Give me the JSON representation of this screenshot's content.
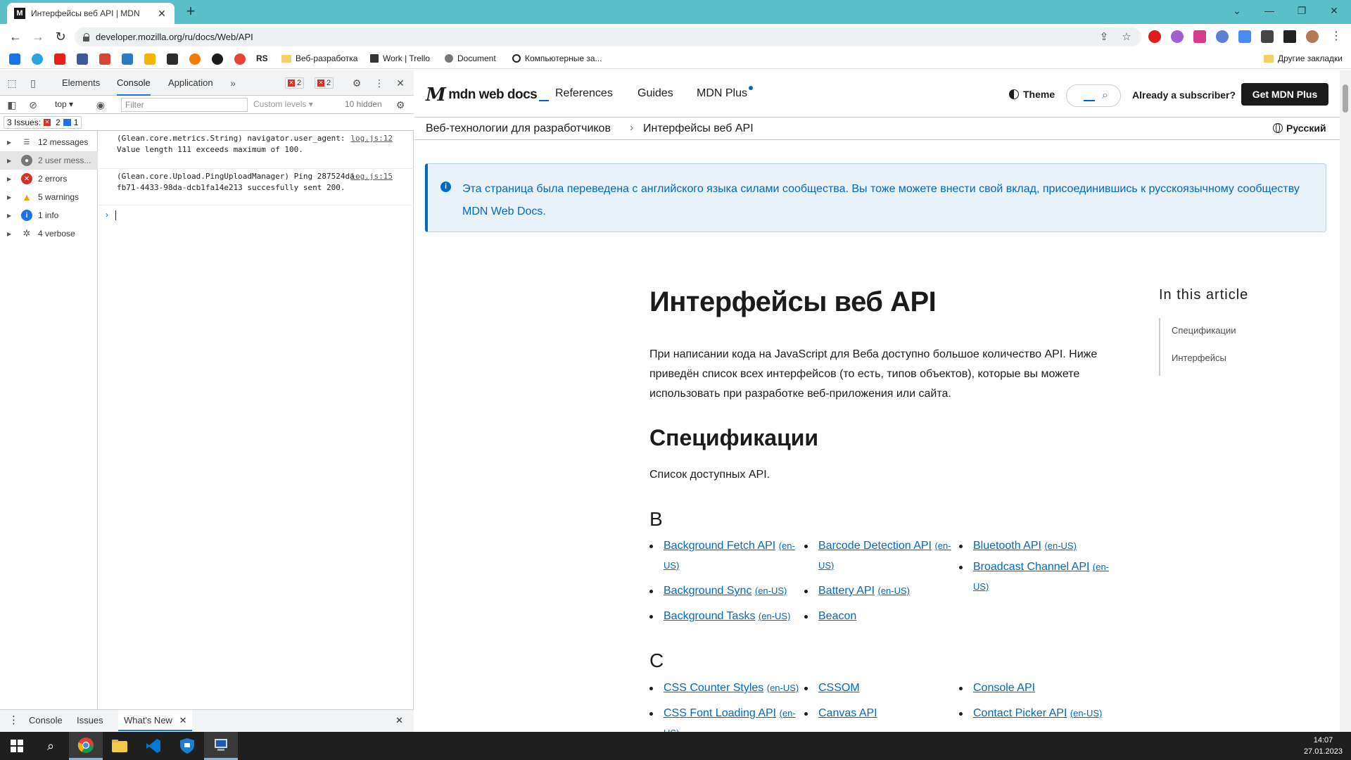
{
  "browser": {
    "tab_title": "Интерфейсы веб API | MDN",
    "url": "developer.mozilla.org/ru/docs/Web/API",
    "bookmarks": [
      "Веб-разработка",
      "Work | Trello",
      "Document",
      "Компьютерные за...",
      "Другие закладки"
    ],
    "bookmarks_short_rs": "RS"
  },
  "devtools": {
    "tabs": [
      "Elements",
      "Console",
      "Application"
    ],
    "error_count": "2",
    "issue_count": "2",
    "context": "top",
    "filter_placeholder": "Filter",
    "levels": "Custom levels",
    "hidden": "10 hidden",
    "issues_label": "3 Issues:",
    "issues_errors": "2",
    "issues_messages": "1",
    "sidebar": [
      {
        "label": "12 messages",
        "icon": "list-icon"
      },
      {
        "label": "2 user mess...",
        "icon": "user-icon"
      },
      {
        "label": "2 errors",
        "icon": "error-icon"
      },
      {
        "label": "5 warnings",
        "icon": "warning-icon"
      },
      {
        "label": "1 info",
        "icon": "info-icon"
      },
      {
        "label": "4 verbose",
        "icon": "bug-icon"
      }
    ],
    "logs": [
      {
        "text": "(Glean.core.metrics.String) navigator.user_agent: Value length 111 exceeds maximum of 100.",
        "src": "log.js:12"
      },
      {
        "text": "(Glean.core.Upload.PingUploadManager) Ping 287524da-fb71-4433-98da-dcb1fa14e213 succesfully sent 200.",
        "src": "log.js:15"
      }
    ],
    "drawer_tabs": [
      "Console",
      "Issues",
      "What's New"
    ]
  },
  "mdn": {
    "logo": "mdn web docs",
    "nav": [
      "References",
      "Guides",
      "MDN Plus"
    ],
    "theme": "Theme",
    "subscriber": "Already a subscriber?",
    "get_plus": "Get MDN Plus",
    "breadcrumbs": [
      "Веб-технологии для разработчиков",
      "Интерфейсы веб API"
    ],
    "language": "Русский",
    "notice": "Эта страница была переведена с английского языка силами сообщества. Вы тоже можете внести свой вклад, присоединившись к русскоязычному сообществу MDN Web Docs.",
    "title": "Интерфейсы веб API",
    "intro": "При написании кода на JavaScript для Веба доступно большое количество API. Ниже приведён список всех интерфейсов (то есть, типов объектов), которые вы можете использовать при разработке веб-приложения или сайта.",
    "h2": "Спецификации",
    "sublead": "Список доступных API.",
    "letter_b": "B",
    "letter_c": "C",
    "en_us": "(en-US)",
    "toc_title": "In this article",
    "toc": [
      "Спецификации",
      "Интерфейсы"
    ],
    "b_col1": [
      "Background Fetch API",
      "Background Sync",
      "Background Tasks"
    ],
    "b_col2": [
      "Barcode Detection API",
      "Battery API",
      "Beacon"
    ],
    "b_col3": [
      "Bluetooth API",
      "Broadcast Channel API"
    ],
    "c_col1": [
      "CSS Counter Styles",
      "CSS Font Loading API"
    ],
    "c_col2": [
      "CSSOM",
      "Canvas API"
    ],
    "c_col3": [
      "Console API",
      "Contact Picker API"
    ]
  },
  "taskbar": {
    "time": "14:07",
    "date": "27.01.2023"
  }
}
